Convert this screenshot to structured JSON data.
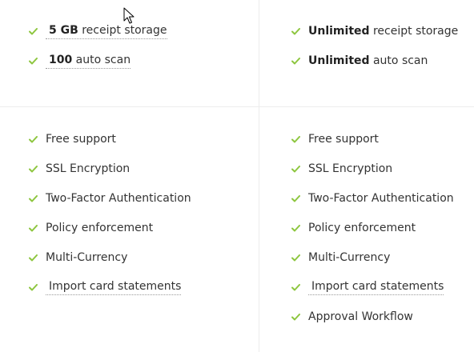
{
  "colors": {
    "check": "#8dc63f",
    "divider": "#ececec",
    "text": "#333333"
  },
  "icons": {
    "check": "check-icon",
    "cursor": "mouse-pointer-icon"
  },
  "plan_left": {
    "limits": [
      {
        "bold": "5 GB",
        "rest": " receipt storage"
      },
      {
        "bold": "100",
        "rest": " auto scan"
      }
    ],
    "features": [
      "Free support",
      "SSL Encryption",
      "Two-Factor Authentication",
      "Policy enforcement",
      "Multi-Currency",
      "Import card statements"
    ]
  },
  "plan_right": {
    "limits": [
      {
        "bold": "Unlimited",
        "rest": " receipt storage"
      },
      {
        "bold": "Unlimited",
        "rest": " auto scan"
      }
    ],
    "features": [
      "Free support",
      "SSL Encryption",
      "Two-Factor Authentication",
      "Policy enforcement",
      "Multi-Currency",
      "Import card statements",
      "Approval Workflow"
    ]
  }
}
